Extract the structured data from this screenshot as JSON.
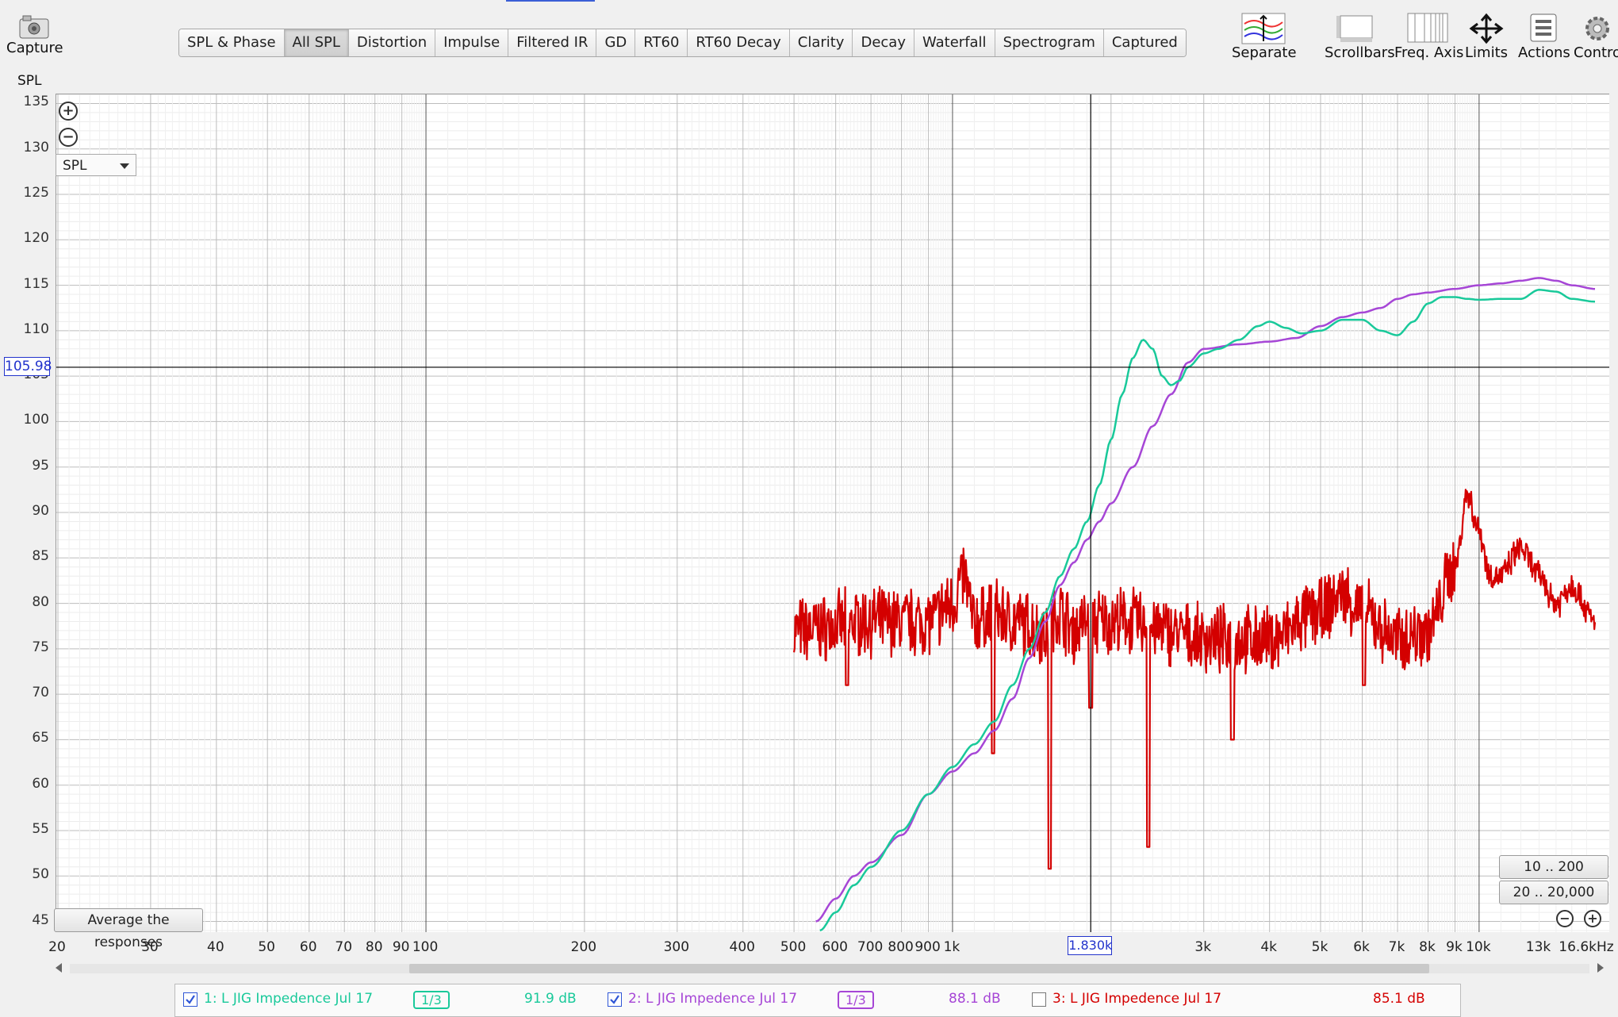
{
  "toolbar": {
    "capture": "Capture",
    "separate": "Separate",
    "scrollbars": "Scrollbars",
    "freq_axis": "Freq. Axis",
    "limits": "Limits",
    "actions": "Actions",
    "controls": "Contro"
  },
  "tabs": [
    "SPL & Phase",
    "All SPL",
    "Distortion",
    "Impulse",
    "Filtered IR",
    "GD",
    "RT60",
    "RT60 Decay",
    "Clarity",
    "Decay",
    "Waterfall",
    "Spectrogram",
    "Captured"
  ],
  "active_tab": "All SPL",
  "graph": {
    "y_axis_title": "SPL",
    "selector_value": "SPL",
    "average_button": "Average the responses",
    "range_btn_1": "10 .. 200",
    "range_btn_2": "20 .. 20,000",
    "cursor_y": "105.98",
    "cursor_x": "1.830k"
  },
  "chart_data": {
    "type": "line",
    "x_scale": "log",
    "xlim": [
      20,
      16600
    ],
    "ylim": [
      44,
      136
    ],
    "grid": true,
    "yticks": [
      45,
      50,
      55,
      60,
      65,
      70,
      75,
      80,
      85,
      90,
      95,
      100,
      105,
      110,
      115,
      120,
      125,
      130,
      135
    ],
    "xticks": [
      {
        "v": 20,
        "t": "20"
      },
      {
        "v": 30,
        "t": "30"
      },
      {
        "v": 40,
        "t": "40"
      },
      {
        "v": 50,
        "t": "50"
      },
      {
        "v": 60,
        "t": "60"
      },
      {
        "v": 70,
        "t": "70"
      },
      {
        "v": 80,
        "t": "80"
      },
      {
        "v": 90,
        "t": "90"
      },
      {
        "v": 100,
        "t": "100"
      },
      {
        "v": 200,
        "t": "200"
      },
      {
        "v": 300,
        "t": "300"
      },
      {
        "v": 400,
        "t": "400"
      },
      {
        "v": 500,
        "t": "500"
      },
      {
        "v": 600,
        "t": "600"
      },
      {
        "v": 700,
        "t": "700"
      },
      {
        "v": 800,
        "t": "800"
      },
      {
        "v": 900,
        "t": "900"
      },
      {
        "v": 1000,
        "t": "1k"
      },
      {
        "v": 3000,
        "t": "3k"
      },
      {
        "v": 4000,
        "t": "4k"
      },
      {
        "v": 5000,
        "t": "5k"
      },
      {
        "v": 6000,
        "t": "6k"
      },
      {
        "v": 7000,
        "t": "7k"
      },
      {
        "v": 8000,
        "t": "8k"
      },
      {
        "v": 9000,
        "t": "9k"
      },
      {
        "v": 10000,
        "t": "10k"
      },
      {
        "v": 13000,
        "t": "13k"
      },
      {
        "v": 16600,
        "t": "16.6kHz"
      }
    ],
    "cursor": {
      "x": 1830,
      "y": 105.98
    },
    "series": [
      {
        "name": "1: L JIG Impedence Jul 17",
        "color": "#19c99a",
        "x": [
          560,
          600,
          650,
          700,
          800,
          900,
          1000,
          1100,
          1200,
          1300,
          1400,
          1500,
          1600,
          1700,
          1800,
          1900,
          2000,
          2100,
          2200,
          2300,
          2400,
          2500,
          2600,
          2700,
          2800,
          3000,
          3200,
          3500,
          3800,
          4000,
          4300,
          4600,
          5000,
          5500,
          6000,
          6500,
          7000,
          7500,
          8000,
          8500,
          9000,
          9500,
          10000,
          11000,
          12000,
          13000,
          14000,
          15000,
          16600
        ],
        "y": [
          44,
          46,
          49,
          51,
          55,
          59,
          62,
          64.5,
          67,
          71,
          75,
          79,
          83,
          86,
          89,
          93,
          98,
          103,
          107,
          109,
          108,
          105,
          104,
          104.5,
          106,
          107.5,
          108,
          109,
          110.5,
          111,
          110.3,
          109.7,
          110,
          111.2,
          111.2,
          110,
          109.5,
          111,
          113,
          113.7,
          113.7,
          113.5,
          113.4,
          113.5,
          113.5,
          114.5,
          114.3,
          113.5,
          113.2
        ]
      },
      {
        "name": "2: L JIG Impedence Jul 17",
        "color": "#a646d6",
        "x": [
          550,
          600,
          650,
          700,
          800,
          900,
          1000,
          1100,
          1200,
          1300,
          1400,
          1500,
          1600,
          1700,
          1800,
          1900,
          2000,
          2200,
          2400,
          2600,
          2800,
          3000,
          3500,
          4000,
          4500,
          5000,
          5500,
          6000,
          6500,
          7000,
          7500,
          8000,
          9000,
          10000,
          11000,
          12000,
          13000,
          14000,
          15000,
          16600
        ],
        "y": [
          45,
          47.5,
          50,
          51.5,
          54.5,
          59,
          61.5,
          63.5,
          66,
          69.5,
          74,
          78,
          82,
          84.5,
          87,
          89,
          91,
          95,
          99.5,
          103,
          106.5,
          108,
          108.5,
          108.8,
          109.2,
          110.5,
          111.5,
          112,
          112.5,
          113.5,
          114,
          114.2,
          114.6,
          115,
          115.2,
          115.5,
          115.8,
          115.5,
          115,
          114.6
        ]
      },
      {
        "name": "3: L JIG Impedence Jul 17",
        "color": "#d40000",
        "xmin": 500,
        "xmax": 16600,
        "x": [
          500,
          700,
          900,
          1000,
          1050,
          1100,
          1200,
          1300,
          1500,
          1600,
          1700,
          1800,
          2000,
          2200,
          2500,
          3000,
          4000,
          5000,
          5500,
          6000,
          7000,
          8000,
          9000,
          9500,
          10000,
          10500,
          11000,
          12000,
          13000,
          14000,
          15000,
          16600
        ],
        "y": [
          77,
          78,
          78,
          80,
          83,
          78,
          79,
          78,
          77,
          79,
          77,
          78,
          78,
          78,
          77,
          76,
          76,
          79,
          81,
          79,
          76,
          77,
          84,
          92,
          88,
          83,
          83,
          86,
          83,
          80,
          82,
          78
        ],
        "noise_amp": 3.2,
        "dips": [
          {
            "x": 1195,
            "y": 63.5
          },
          {
            "x": 1530,
            "y": 50.8
          },
          {
            "x": 1830,
            "y": 68.5
          },
          {
            "x": 2355,
            "y": 53.2
          },
          {
            "x": 3400,
            "y": 65
          },
          {
            "x": 6050,
            "y": 71
          },
          {
            "x": 630,
            "y": 71
          }
        ]
      }
    ]
  },
  "legend": [
    {
      "label": "1: L JIG Impedence Jul 17",
      "checked": true,
      "smoothing": "1/3",
      "level": "91.9 dB"
    },
    {
      "label": "2: L JIG Impedence Jul 17",
      "checked": true,
      "smoothing": "1/3",
      "level": "88.1 dB"
    },
    {
      "label": "3: L JIG Impedence Jul 17",
      "checked": false,
      "smoothing": "",
      "level": "85.1 dB"
    }
  ]
}
